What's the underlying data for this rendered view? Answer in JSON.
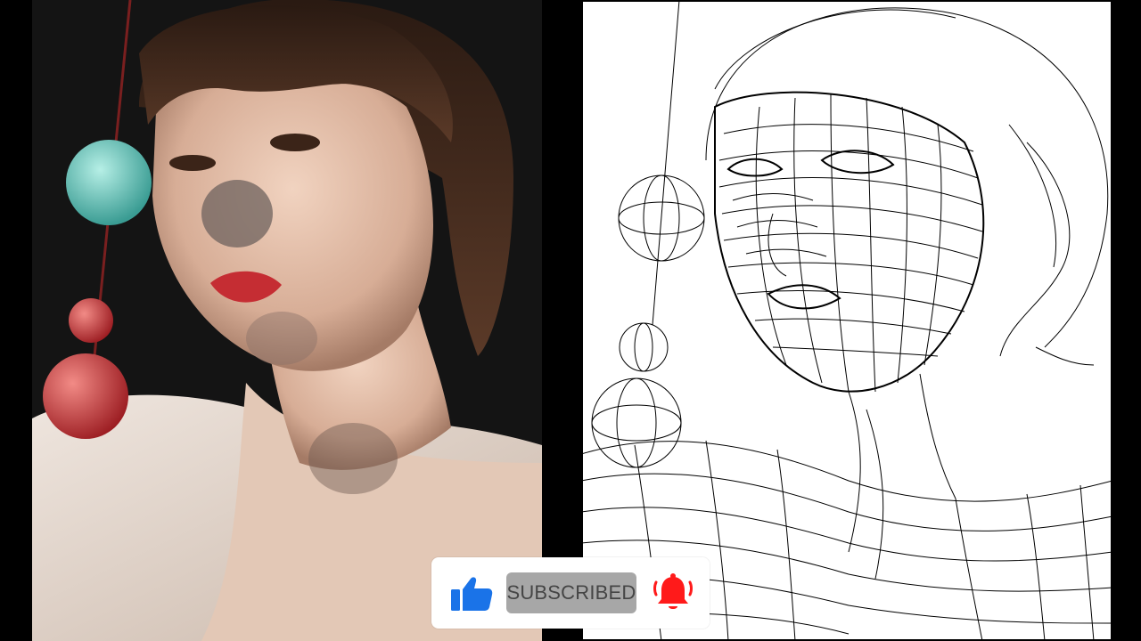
{
  "subscribe_overlay": {
    "subscribed_label": "SUBSCRIBED",
    "like_icon": "thumbs-up-icon",
    "bell_icon": "notification-bell-icon",
    "colors": {
      "like": "#1a73e8",
      "bell": "#ff1a1a",
      "button_bg": "#a7a7a7",
      "button_text": "#454545"
    }
  },
  "left_panel": {
    "content": "painted-portrait"
  },
  "right_panel": {
    "content": "wireframe-line-drawing"
  }
}
